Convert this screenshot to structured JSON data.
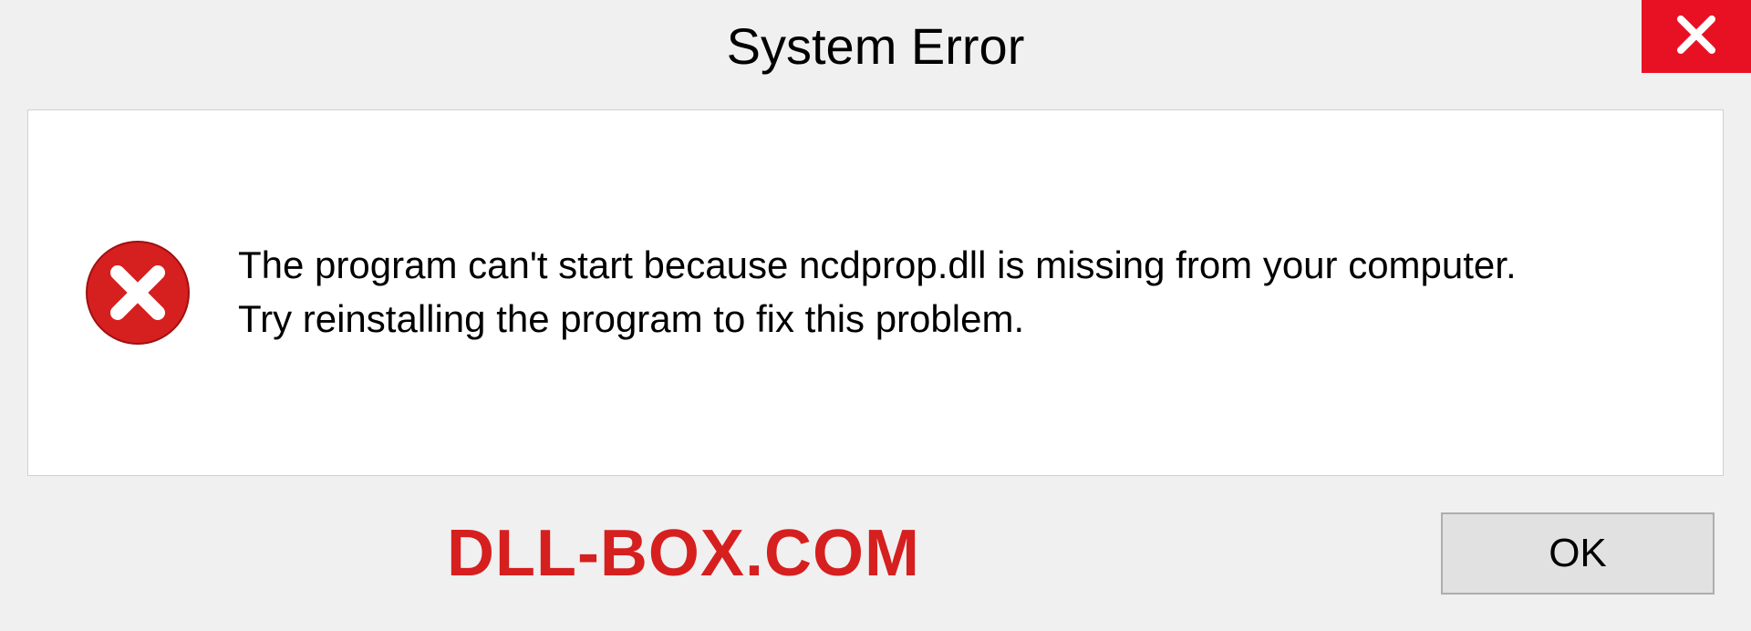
{
  "dialog": {
    "title": "System Error",
    "message_line1": "The program can't start because ncdprop.dll is missing from your computer.",
    "message_line2": "Try reinstalling the program to fix this problem.",
    "ok_label": "OK"
  },
  "watermark": "DLL-BOX.COM",
  "colors": {
    "close_button": "#e81123",
    "error_icon": "#d61f1f",
    "watermark": "#d61f1f"
  }
}
